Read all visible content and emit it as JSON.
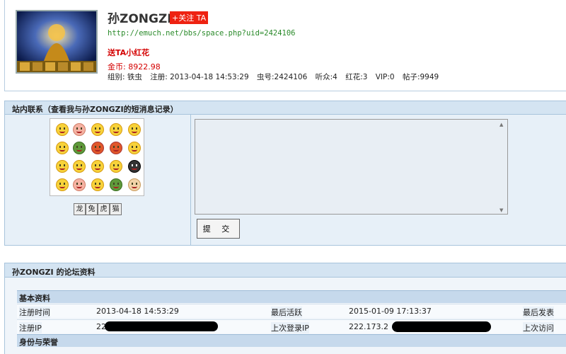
{
  "profile": {
    "username": "孙ZONGZI",
    "follow_label": "+关注 TA",
    "space_url": "http://emuch.net/bbs/space.php?uid=2424106",
    "send_flower": "送TA小红花",
    "coins": "金币: 8922.98",
    "stats": [
      "组别: 铁虫",
      "注册: 2013-04-18 14:53:29",
      "虫号:2424106",
      "听众:4",
      "红花:3",
      "VIP:0",
      "帖子:9949"
    ]
  },
  "message_section": {
    "title": "站内联系（查看我与孙ZONGZI的短消息记录）",
    "style_buttons": [
      "龙",
      "兔",
      "虎",
      "猫"
    ],
    "textarea_value": "",
    "submit_label": "提 交"
  },
  "forum_section": {
    "title": "孙ZONGZI 的论坛资料",
    "basic_header": "基本资料",
    "rows": [
      {
        "label1": "注册时间",
        "value1": "2013-04-18 14:53:29",
        "label2": "最后活跃",
        "value2": "2015-01-09 17:13:37",
        "label3": "最后发表"
      },
      {
        "label1": "注册IP",
        "value1": "222",
        "label2": "上次登录IP",
        "value2": "222.173.2",
        "label3": "上次访问"
      }
    ],
    "identity_header": "身份与荣誉"
  },
  "colors": {
    "accent_red": "#d40000",
    "link_green": "#2a8a2a",
    "section_bar": "#d4e4f2"
  }
}
